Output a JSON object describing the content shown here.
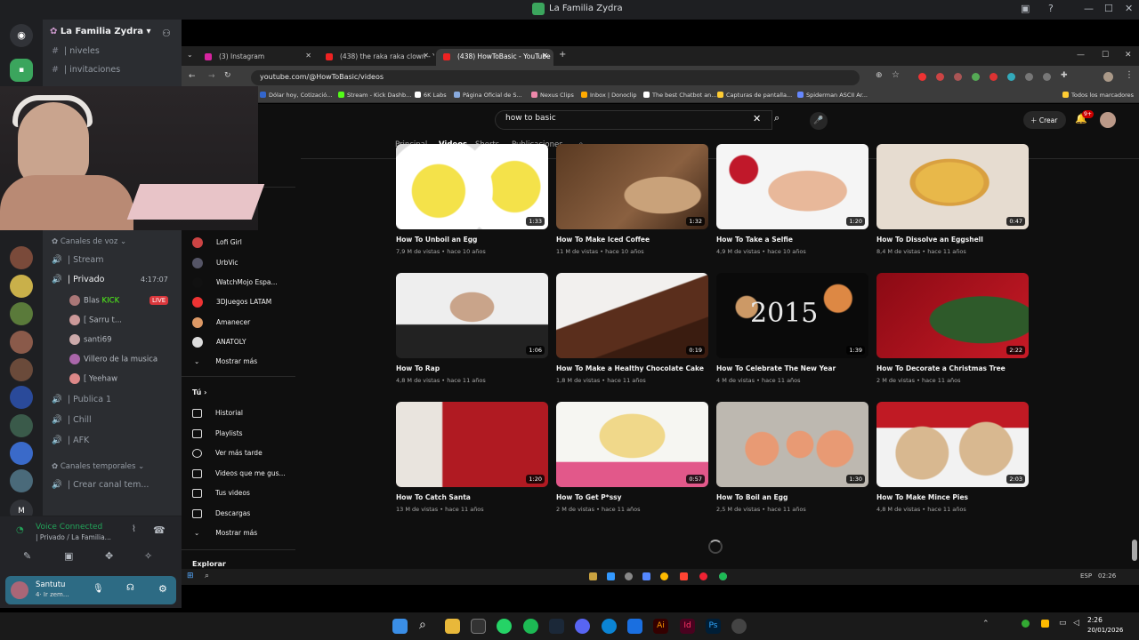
{
  "discord": {
    "window_title": "La Familia Zydra",
    "server_name": "La Familia Zydra",
    "channels_top": [
      {
        "label": "niveles"
      },
      {
        "label": "invitaciones"
      }
    ],
    "category_voice": "Canales de voz",
    "voice_channels": [
      {
        "label": "Stream"
      },
      {
        "label": "Privado",
        "timer": "4:17:07"
      }
    ],
    "users": [
      {
        "name": "Blas",
        "tag": "KICK",
        "live": "LIVE"
      },
      {
        "name": "[ Sarru t...",
        "live": ""
      },
      {
        "name": "santi69",
        "live": ""
      },
      {
        "name": "Villero de la musica",
        "live": ""
      },
      {
        "name": "[ Yeehaw",
        "live": ""
      }
    ],
    "voice_channels2": [
      {
        "label": "Publica 1"
      },
      {
        "label": "Chill"
      },
      {
        "label": "AFK"
      }
    ],
    "category_temp": "Canales temporales",
    "create_channel": "Crear canal tem...",
    "voice_status": "Voice Connected",
    "voice_sub": "| Privado / La Familia...",
    "user_name": "Santutu",
    "user_status": "4· Ir zem..."
  },
  "browser": {
    "tabs": [
      {
        "label": "(3) Instagram"
      },
      {
        "label": "(438) the raka raka clown - You"
      },
      {
        "label": "(438) HowToBasic - YouTube"
      }
    ],
    "url": "youtube.com/@HowToBasic/videos",
    "bookmarks": [
      "Dólar hoy, Cotizació...",
      "Stream - Kick Dashb...",
      "6K Labs",
      "Página Oficial de S...",
      "Nexus Clips",
      "Inbox | Donoclip",
      "The best Chatbot an...",
      "Capturas de pantalla...",
      "Spiderman ASCII Ar..."
    ],
    "bookmarks_right": "Todos los marcadores"
  },
  "youtube": {
    "search_query": "how to basic",
    "create_label": "Crear",
    "notif_count": "9+",
    "tabs": [
      "Principal",
      "Videos",
      "Shorts",
      "Publicaciones"
    ],
    "active_tab": "Videos",
    "subs": [
      {
        "name": "Lofi Girl"
      },
      {
        "name": "UrbVic"
      },
      {
        "name": "WatchMojo Espa..."
      },
      {
        "name": "3DJuegos LATAM"
      },
      {
        "name": "Amanecer"
      },
      {
        "name": "ANATOLY"
      }
    ],
    "show_more": "Mostrar más",
    "you_label": "Tú",
    "you_items": [
      "Historial",
      "Playlists",
      "Ver más tarde",
      "Videos que me gus...",
      "Tus videos",
      "Descargas",
      "Mostrar más"
    ],
    "explore": "Explorar",
    "videos": [
      {
        "title": "How To Unboil an Egg",
        "meta": "7,9 M de vistas • hace 10 años",
        "dur": "1:33"
      },
      {
        "title": "How To Make Iced Coffee",
        "meta": "11 M de vistas • hace 10 años",
        "dur": "1:32"
      },
      {
        "title": "How To Take a Selfie",
        "meta": "4,9 M de vistas • hace 10 años",
        "dur": "1:20"
      },
      {
        "title": "How To Dissolve an Eggshell",
        "meta": "8,4 M de vistas • hace 11 años",
        "dur": "0:47"
      },
      {
        "title": "How To Rap",
        "meta": "4,8 M de vistas • hace 11 años",
        "dur": "1:06"
      },
      {
        "title": "How To Make a Healthy Chocolate Cake",
        "meta": "1,8 M de vistas • hace 11 años",
        "dur": "0:19"
      },
      {
        "title": "How To Celebrate The New Year",
        "meta": "4 M de vistas • hace 11 años",
        "dur": "1:39"
      },
      {
        "title": "How To Decorate a Christmas Tree",
        "meta": "2 M de vistas • hace 11 años",
        "dur": "2:22"
      },
      {
        "title": "How To Catch Santa",
        "meta": "13 M de vistas • hace 11 años",
        "dur": "1:20"
      },
      {
        "title": "How To Get P*ssy",
        "meta": "2 M de vistas • hace 11 años",
        "dur": "0:57"
      },
      {
        "title": "How To Boil an Egg",
        "meta": "2,5 M de vistas • hace 11 años",
        "dur": "1:30"
      },
      {
        "title": "How To Make Mince Pies",
        "meta": "4,8 M de vistas • hace 11 años",
        "dur": "2:03"
      }
    ],
    "thumb_text_2015": "2015"
  },
  "inner_taskbar": {
    "lang": "ESP",
    "time": "02:26"
  },
  "taskbar": {
    "time": "2:26",
    "date": "20/01/2026"
  }
}
